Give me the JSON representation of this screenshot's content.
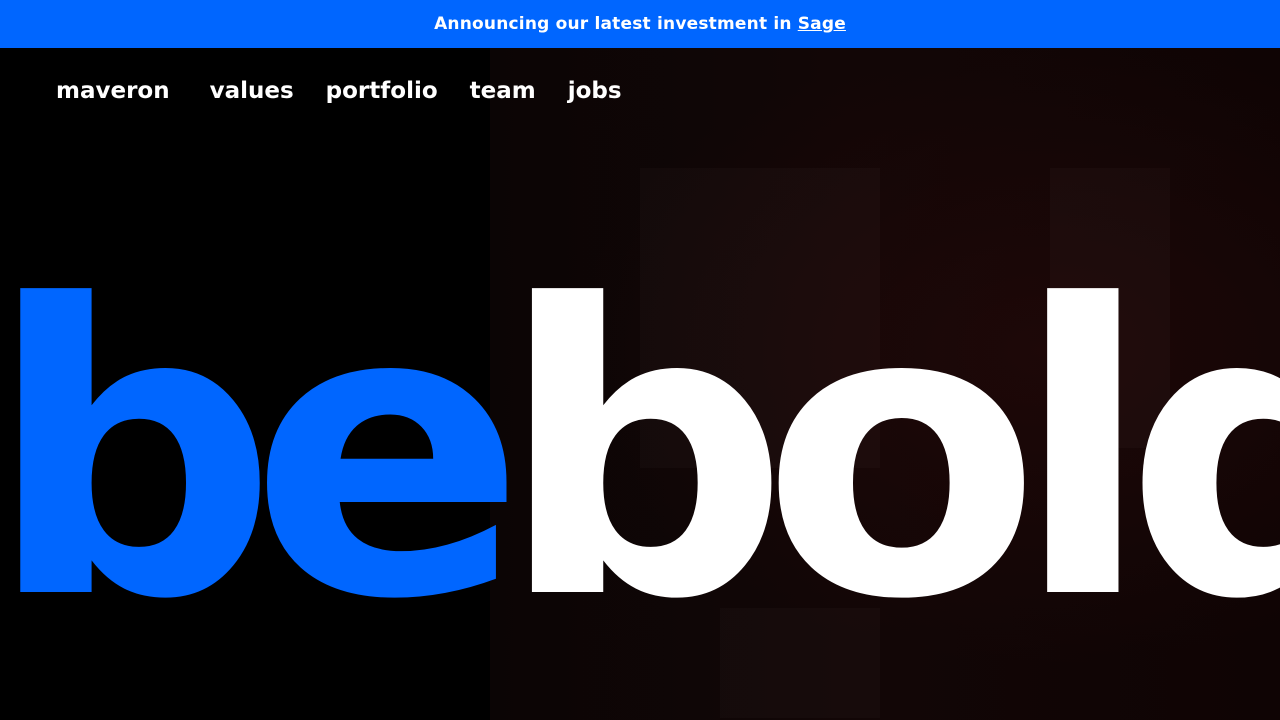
{
  "announcement": {
    "text": "Announcing our latest investment in",
    "link_label": "Sage"
  },
  "nav": {
    "logo": "maveron",
    "links": [
      "values",
      "portfolio",
      "team",
      "jobs"
    ]
  },
  "hero": {
    "word_part1": "be",
    "word_part2": "bold"
  },
  "colors": {
    "accent": "#0066ff",
    "background": "#000000",
    "text": "#ffffff"
  }
}
